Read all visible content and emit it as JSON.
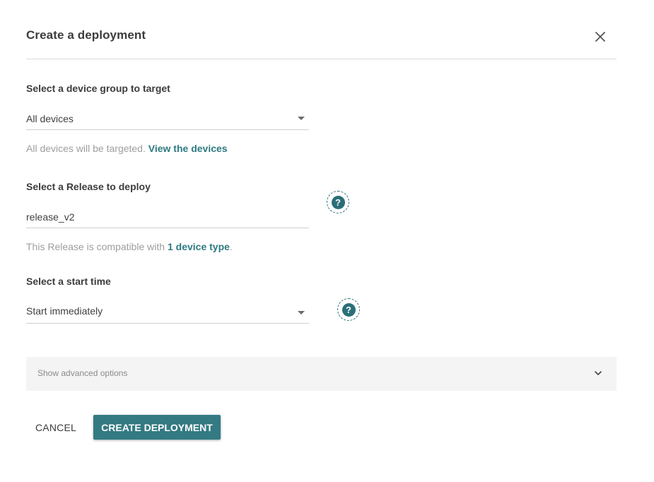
{
  "dialog": {
    "title": "Create a deployment",
    "close_icon": "close-icon"
  },
  "device_group": {
    "label": "Select a device group to target",
    "selected": "All devices",
    "help_prefix": "All devices will be targeted.",
    "help_link": "View the devices"
  },
  "release": {
    "label": "Select a Release to deploy",
    "value": "release_v2",
    "help_prefix": "This Release is compatible with",
    "help_link": "1 device type",
    "help_suffix": ".",
    "help_icon": "question-icon",
    "help_icon_glyph": "?"
  },
  "start_time": {
    "label": "Select a start time",
    "selected": "Start immediately",
    "help_icon": "question-icon",
    "help_icon_glyph": "?"
  },
  "advanced": {
    "label": "Show advanced options",
    "icon": "chevron-down-icon"
  },
  "actions": {
    "cancel_label": "CANCEL",
    "create_label": "CREATE DEPLOYMENT"
  },
  "colors": {
    "accent": "#337a83",
    "link": "#2d7a82",
    "help_text": "#9e9e9e",
    "advanced_bg": "#f4f4f4"
  }
}
